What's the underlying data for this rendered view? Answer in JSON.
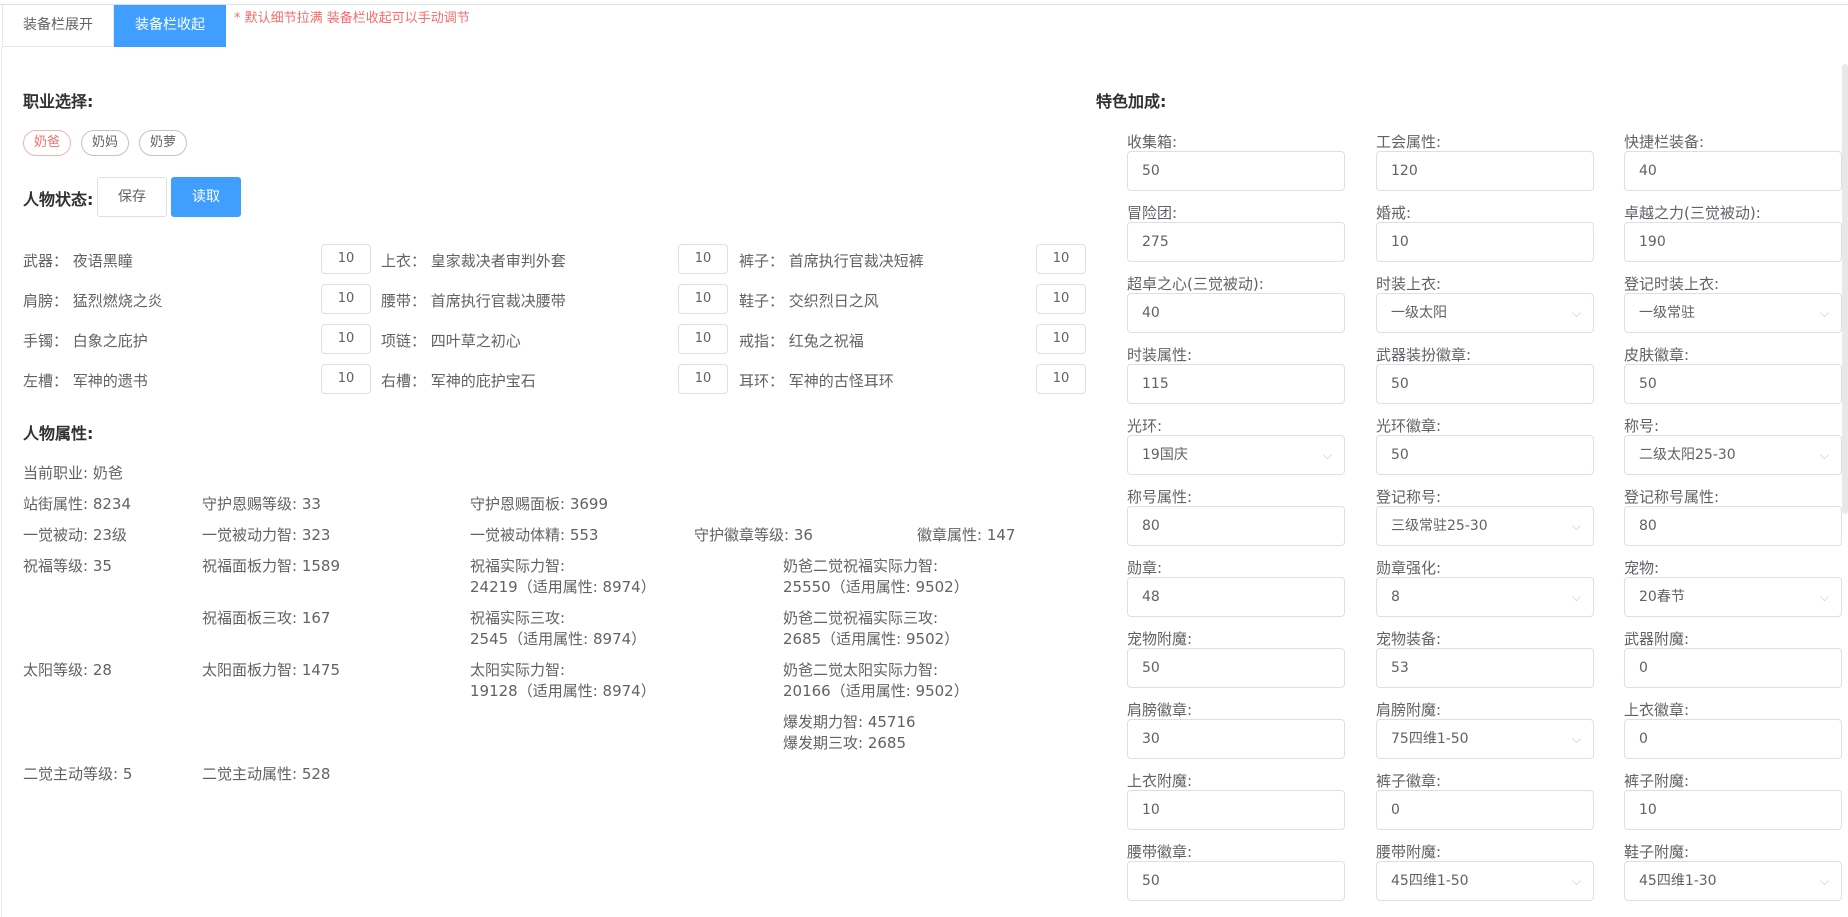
{
  "tabs": [
    {
      "label": "装备栏展开",
      "active": false
    },
    {
      "label": "装备栏收起",
      "active": true
    }
  ],
  "tab_note": "* 默认细节拉满 装备栏收起可以手动调节",
  "left": {
    "job_title": "职业选择:",
    "jobs": [
      {
        "label": "奶爸",
        "active": true
      },
      {
        "label": "奶妈",
        "active": false
      },
      {
        "label": "奶萝",
        "active": false
      }
    ],
    "state_title": "人物状态:",
    "save_label": "保存",
    "load_label": "读取",
    "equipment": [
      {
        "label": "武器： 夜语黑瞳",
        "value": "10"
      },
      {
        "label": "上衣： 皇家裁决者审判外套",
        "value": "10"
      },
      {
        "label": "裤子： 首席执行官裁决短裤",
        "value": "10"
      },
      {
        "label": "肩膀： 猛烈燃烧之炎",
        "value": "10"
      },
      {
        "label": "腰带： 首席执行官裁决腰带",
        "value": "10"
      },
      {
        "label": "鞋子： 交织烈日之风",
        "value": "10"
      },
      {
        "label": "手镯： 白象之庇护",
        "value": "10"
      },
      {
        "label": "项链： 四叶草之初心",
        "value": "10"
      },
      {
        "label": "戒指： 红兔之祝福",
        "value": "10"
      },
      {
        "label": "左槽： 军神的遗书",
        "value": "10"
      },
      {
        "label": "右槽： 军神的庇护宝石",
        "value": "10"
      },
      {
        "label": "耳环： 军神的古怪耳环",
        "value": "10"
      }
    ],
    "attr_title": "人物属性:",
    "stats": {
      "current_job": "当前职业:  奶爸",
      "street": "站街属性:  8234",
      "guard_level": "守护恩赐等级:  33",
      "guard_panel": "守护恩赐面板:  3699",
      "awake1": "一觉被动:  23级",
      "awake1_int": "一觉被动力智: 323",
      "awake1_vit": "一觉被动体精: 553",
      "guard_badge_level": "守护徽章等级:  36",
      "badge_attr": "徽章属性:  147",
      "bless_level": "祝福等级:  35",
      "bless_panel_int": "祝福面板力智:  1589",
      "bless_real_int_1": "祝福实际力智:",
      "bless_real_int_2": "24219（适用属性: 8974）",
      "dad_bless_int_1": "奶爸二觉祝福实际力智:",
      "dad_bless_int_2": "25550（适用属性: 9502）",
      "bless_panel_atk": "祝福面板三攻:  167",
      "bless_real_atk_1": "祝福实际三攻:",
      "bless_real_atk_2": "2545（适用属性: 8974）",
      "dad_bless_atk_1": "奶爸二觉祝福实际三攻:",
      "dad_bless_atk_2": "2685（适用属性: 9502）",
      "sun_level": "太阳等级:  28",
      "sun_panel_int": "太阳面板力智:  1475",
      "sun_real_int_1": "太阳实际力智:",
      "sun_real_int_2": "19128（适用属性: 8974）",
      "dad_sun_int_1": "奶爸二觉太阳实际力智:",
      "dad_sun_int_2": "20166（适用属性: 9502）",
      "burst_int": "爆发期力智:  45716",
      "burst_atk": "爆发期三攻:  2685",
      "awake2_level": "二觉主动等级:  5",
      "awake2_attr": "二觉主动属性:  528"
    }
  },
  "right": {
    "title": "特色加成:",
    "fields": [
      {
        "label": "收集箱:",
        "value": "50",
        "type": "input"
      },
      {
        "label": "工会属性:",
        "value": "120",
        "type": "input"
      },
      {
        "label": "快捷栏装备:",
        "value": "40",
        "type": "input"
      },
      {
        "label": "冒险团:",
        "value": "275",
        "type": "input"
      },
      {
        "label": "婚戒:",
        "value": "10",
        "type": "input"
      },
      {
        "label": "卓越之力(三觉被动):",
        "value": "190",
        "type": "input"
      },
      {
        "label": "超卓之心(三觉被动):",
        "value": "40",
        "type": "input"
      },
      {
        "label": "时装上衣:",
        "value": "一级太阳",
        "type": "select"
      },
      {
        "label": "登记时装上衣:",
        "value": "一级常驻",
        "type": "select"
      },
      {
        "label": "时装属性:",
        "value": "115",
        "type": "input"
      },
      {
        "label": "武器装扮徽章:",
        "value": "50",
        "type": "input"
      },
      {
        "label": "皮肤徽章:",
        "value": "50",
        "type": "input"
      },
      {
        "label": "光环:",
        "value": "19国庆",
        "type": "select"
      },
      {
        "label": "光环徽章:",
        "value": "50",
        "type": "input"
      },
      {
        "label": "称号:",
        "value": "二级太阳25-30",
        "type": "select"
      },
      {
        "label": "称号属性:",
        "value": "80",
        "type": "input"
      },
      {
        "label": "登记称号:",
        "value": "三级常驻25-30",
        "type": "select"
      },
      {
        "label": "登记称号属性:",
        "value": "80",
        "type": "input"
      },
      {
        "label": "勋章:",
        "value": "48",
        "type": "input"
      },
      {
        "label": "勋章强化:",
        "value": "8",
        "type": "select"
      },
      {
        "label": "宠物:",
        "value": "20春节",
        "type": "select"
      },
      {
        "label": "宠物附魔:",
        "value": "50",
        "type": "input"
      },
      {
        "label": "宠物装备:",
        "value": "53",
        "type": "input"
      },
      {
        "label": "武器附魔:",
        "value": "0",
        "type": "input"
      },
      {
        "label": "肩膀徽章:",
        "value": "30",
        "type": "input"
      },
      {
        "label": "肩膀附魔:",
        "value": "75四维1-50",
        "type": "select"
      },
      {
        "label": "上衣徽章:",
        "value": "0",
        "type": "input"
      },
      {
        "label": "上衣附魔:",
        "value": "10",
        "type": "input"
      },
      {
        "label": "裤子徽章:",
        "value": "0",
        "type": "input"
      },
      {
        "label": "裤子附魔:",
        "value": "10",
        "type": "input"
      },
      {
        "label": "腰带徽章:",
        "value": "50",
        "type": "input"
      },
      {
        "label": "腰带附魔:",
        "value": "45四维1-50",
        "type": "select"
      },
      {
        "label": "鞋子附魔:",
        "value": "45四维1-30",
        "type": "select"
      }
    ]
  },
  "colors": {
    "primary": "#409eff",
    "danger": "#f56c6c",
    "text": "#606266",
    "border": "#dcdfe6"
  }
}
